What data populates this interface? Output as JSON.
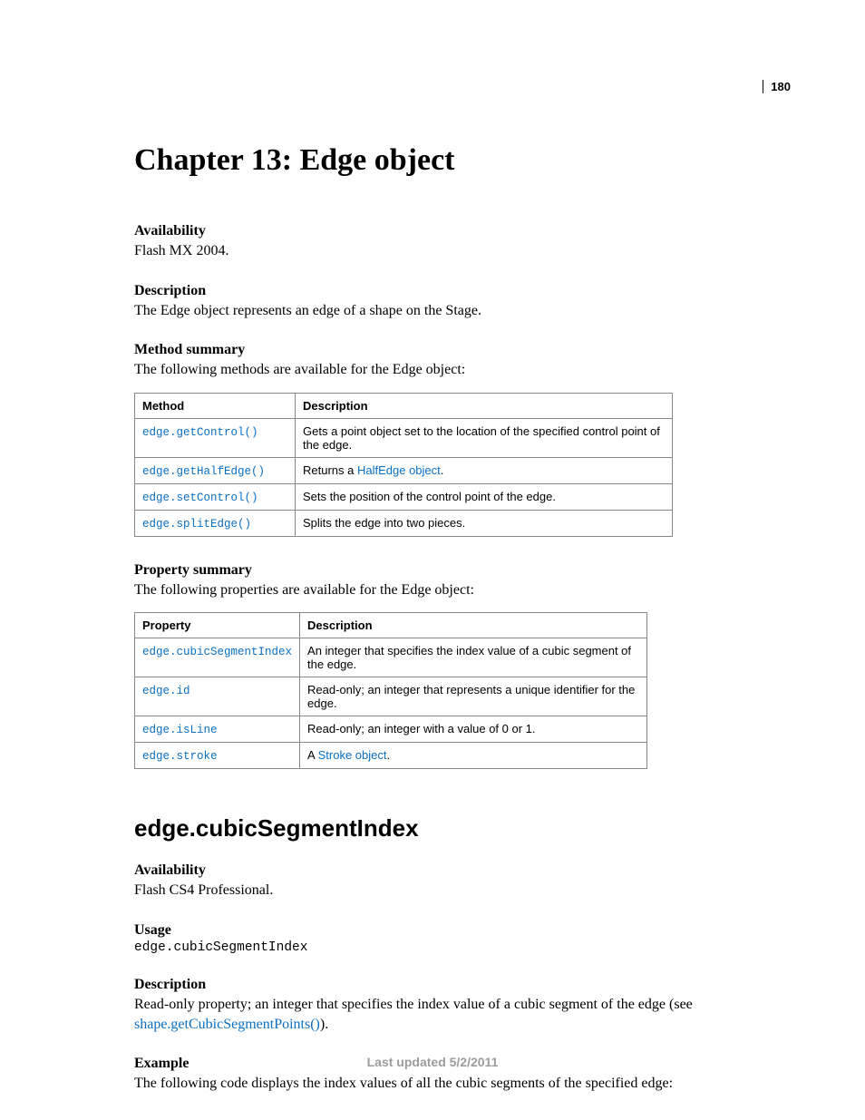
{
  "page_number": "180",
  "chapter_title": "Chapter 13: Edge object",
  "availability_label": "Availability",
  "availability_text": "Flash MX 2004.",
  "description_label": "Description",
  "description_text": "The Edge object represents an edge of a shape on the Stage.",
  "method_summary_label": "Method summary",
  "method_summary_text": "The following methods are available for the Edge object:",
  "method_table": {
    "h1": "Method",
    "h2": "Description",
    "rows": [
      {
        "m": "edge.getControl()",
        "d_pre": "Gets a point object set to the location of the specified control point of the edge.",
        "link": "",
        "d_post": ""
      },
      {
        "m": "edge.getHalfEdge()",
        "d_pre": "Returns a ",
        "link": "HalfEdge object",
        "d_post": "."
      },
      {
        "m": "edge.setControl()",
        "d_pre": "Sets the position of the control point of the edge.",
        "link": "",
        "d_post": ""
      },
      {
        "m": "edge.splitEdge()",
        "d_pre": "Splits the edge into two pieces.",
        "link": "",
        "d_post": ""
      }
    ]
  },
  "property_summary_label": "Property summary",
  "property_summary_text": "The following properties are available for the Edge object:",
  "property_table": {
    "h1": "Property",
    "h2": "Description",
    "rows": [
      {
        "p": "edge.cubicSegmentIndex",
        "d_pre": "An integer that specifies the index value of a cubic segment of the edge.",
        "link": "",
        "d_post": ""
      },
      {
        "p": "edge.id",
        "d_pre": "Read-only; an integer that represents a unique identifier for the edge.",
        "link": "",
        "d_post": ""
      },
      {
        "p": "edge.isLine",
        "d_pre": "Read-only; an integer with a value of 0 or 1.",
        "link": "",
        "d_post": ""
      },
      {
        "p": "edge.stroke",
        "d_pre": "A ",
        "link": "Stroke object",
        "d_post": "."
      }
    ]
  },
  "section_heading": "edge.cubicSegmentIndex",
  "sec_availability_label": "Availability",
  "sec_availability_text": "Flash CS4 Professional.",
  "usage_label": "Usage",
  "usage_code": "edge.cubicSegmentIndex",
  "sec_description_label": "Description",
  "sec_description_pre": "Read-only property; an integer that specifies the index value of a cubic segment of the edge (see ",
  "sec_description_link": "shape.getCubicSegmentPoints()",
  "sec_description_post": ").",
  "example_label": "Example",
  "example_text": "The following code displays the index values of all the cubic segments of the specified edge:",
  "footer": "Last updated 5/2/2011"
}
